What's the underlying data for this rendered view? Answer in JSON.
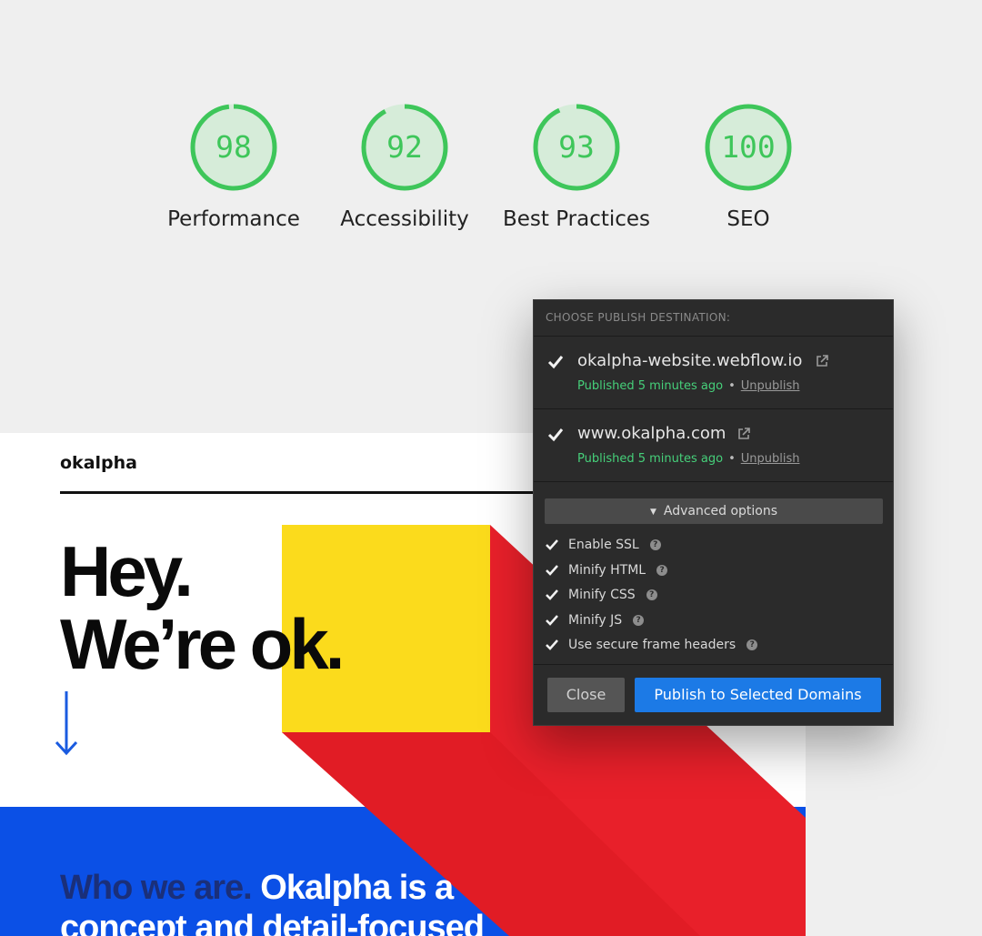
{
  "scores": [
    {
      "value": "98",
      "label": "Performance",
      "fraction": 0.98
    },
    {
      "value": "92",
      "label": "Accessibility",
      "fraction": 0.92
    },
    {
      "value": "93",
      "label": "Best Practices",
      "fraction": 0.93
    },
    {
      "value": "100",
      "label": "SEO",
      "fraction": 1.0
    }
  ],
  "colors": {
    "score_green": "#3ec65a",
    "score_fill": "#d6ecd9",
    "panel_bg": "#2b2b2b",
    "publish_blue": "#1c7ae6",
    "status_green": "#46d07a",
    "site_blue": "#0b50e6",
    "site_yellow": "#fbdb1c",
    "site_red": "#e8202a"
  },
  "site": {
    "logo": "okalpha",
    "headline_1": "Hey.",
    "headline_2": "We’re ok.",
    "who_dim": "Who we are.",
    "who_bright": " Okalpha is a",
    "who_line2": "concept and detail-focused",
    "arrow_icon": "down-arrow-icon"
  },
  "panel": {
    "heading": "CHOOSE PUBLISH DESTINATION:",
    "domains": [
      {
        "name": "okalpha-website.webflow.io",
        "status": "Published 5 minutes ago",
        "separator": "•",
        "unpublish": "Unpublish",
        "checked": true
      },
      {
        "name": "www.okalpha.com",
        "status": "Published 5 minutes ago",
        "separator": "•",
        "unpublish": "Unpublish",
        "checked": true
      }
    ],
    "advanced_label": "Advanced options",
    "options": [
      {
        "label": "Enable SSL",
        "checked": true
      },
      {
        "label": "Minify HTML",
        "checked": true
      },
      {
        "label": "Minify CSS",
        "checked": true
      },
      {
        "label": "Minify JS",
        "checked": true
      },
      {
        "label": "Use secure frame headers",
        "checked": true
      }
    ],
    "help_glyph": "?",
    "close_label": "Close",
    "publish_label": "Publish to Selected Domains"
  }
}
